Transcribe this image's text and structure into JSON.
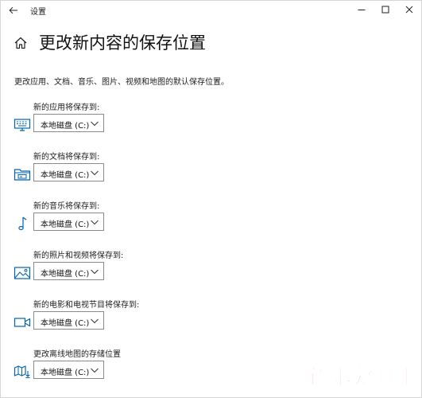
{
  "window": {
    "title": "设置"
  },
  "header": {
    "title": "更改新内容的保存位置",
    "description": "更改应用、文档、音乐、图片、视频和地图的默认保存位置。"
  },
  "sections": [
    {
      "label": "新的应用将保存到:",
      "value": "本地磁盘 (C:)",
      "icon": "monitor-icon"
    },
    {
      "label": "新的文档将保存到:",
      "value": "本地磁盘 (C:)",
      "icon": "folder-drive-icon"
    },
    {
      "label": "新的音乐将保存到:",
      "value": "本地磁盘 (C:)",
      "icon": "music-note-icon"
    },
    {
      "label": "新的照片和视频将保存到:",
      "value": "本地磁盘 (C:)",
      "icon": "image-icon"
    },
    {
      "label": "新的电影和电视节目将保存到:",
      "value": "本地磁盘 (C:)",
      "icon": "video-camera-icon"
    },
    {
      "label": "更改离线地图的存储位置",
      "value": "本地磁盘 (C:)",
      "icon": "map-download-icon"
    }
  ],
  "watermark": {
    "text": "宝哥软件园"
  },
  "colors": {
    "accent": "#0063b1",
    "border": "#8a8a8a",
    "watermark": "#e0484a"
  }
}
